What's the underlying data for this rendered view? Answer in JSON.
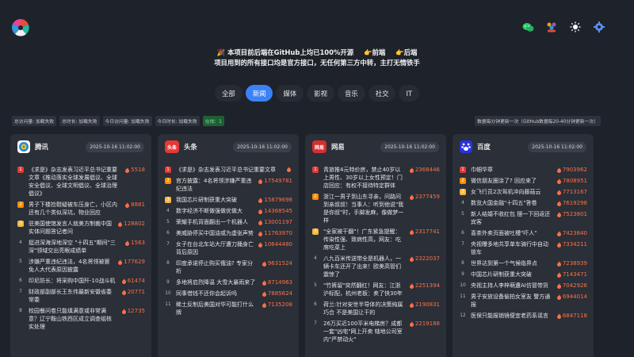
{
  "notice": {
    "line1_prefix": "🎉 本项目前后端在GitHub上均已100%开源",
    "frontend_link": "👉前端",
    "backend_link": "👉后端",
    "line2": "项目用到的所有接口均是官方接口，无任何第三方中转，主打无情铁手"
  },
  "tabs": [
    "全部",
    "新闻",
    "媒体",
    "影视",
    "音乐",
    "社交",
    "IT"
  ],
  "active_tab": "新闻",
  "stats": [
    "总访问量: 加载失败",
    "总时长: 加载失败",
    "今日访问量: 加载失败",
    "今日时长: 加载失败"
  ],
  "online": "在线：1",
  "update_note": "数据每分钟更新一次（GitHub数据每20-40分钟更新一次）",
  "colors": {
    "accent": "#3b82f6",
    "bg": "#1e222a",
    "card": "#2a2f38",
    "heat": "#ff7043"
  },
  "icons": [
    "wechat-icon",
    "community-icon",
    "theme-sun-icon",
    "settings-gear-icon"
  ],
  "columns": [
    {
      "name": "腾讯",
      "logo_text": "",
      "logo_color": "#ffffff",
      "time": "2025-10-16 11:02:00",
      "items": [
        {
          "rank": "1",
          "title": "《求是》杂志发表习近平总书记重要文章《推动落实全球发展倡议、全球安全倡议、全球文明倡议、全球治理倡议》",
          "heat": "5518"
        },
        {
          "rank": "2",
          "title": "男子下楼捡鞋疑被车压身亡，小区内还有几个类似深坑，物业回应",
          "heat": "8881"
        },
        {
          "rank": "3",
          "title": "驻美国使馆发言人就美方制裁中国实体问题答记者问",
          "heat": "128802"
        },
        {
          "rank": "4",
          "title": "挺进深海深地深空 \"十四五\"期间\"三深\"领域交出亮眼成绩单",
          "heat": "1563"
        },
        {
          "rank": "5",
          "title": "涉嫌严重违纪违法，4名将领被罢免人大代表原因披露",
          "heat": "177629"
        },
        {
          "rank": "6",
          "title": "印尼防长：将采购中国歼-10战斗机",
          "heat": "61474"
        },
        {
          "rank": "7",
          "title": "财政部副部长王东伟最新安徽省委常委",
          "heat": "20771"
        },
        {
          "rank": "8",
          "title": "校园餐问卷只能填满意或非常满意？辽宁鞍山铁西区成立调查组核实处理",
          "heat": "12735"
        }
      ]
    },
    {
      "name": "头条",
      "logo_text": "头条",
      "logo_color": "#e53935",
      "time": "2025-10-16 11:02:00",
      "items": [
        {
          "rank": "1",
          "title": "《求是》杂志发表习近平总书记重要文章",
          "heat": ""
        },
        {
          "rank": "2",
          "title": "官方披露：4名将领涉嫌严重违纪违法",
          "heat": "17549781"
        },
        {
          "rank": "3",
          "title": "我国芯片研制获重大突破",
          "heat": "15879698"
        },
        {
          "rank": "4",
          "title": "数字经济不断做强做优做大",
          "heat": "14368545"
        },
        {
          "rank": "5",
          "title": "荣耀手机背面翻出一个机器人",
          "heat": "13001197"
        },
        {
          "rank": "6",
          "title": "美威胁停买中国油或为虚张声势",
          "heat": "11763970"
        },
        {
          "rank": "7",
          "title": "女子在台北车站大厅遭刀捅身亡背后原因",
          "heat": "10644480"
        },
        {
          "rank": "8",
          "title": "印度承诺停止购买俄油? 专家分析",
          "heat": "9631524"
        },
        {
          "rank": "9",
          "title": "多地将启烈降温 大雪大暴雨来了",
          "heat": "8714963"
        },
        {
          "rank": "10",
          "title": "同事借钱不还你会起诉吗",
          "heat": "7885624"
        },
        {
          "rank": "11",
          "title": "稀土反制后美国对华可能打什么牌",
          "heat": "7135208"
        }
      ]
    },
    {
      "name": "网易",
      "logo_text": "网易",
      "logo_color": "#d32f2f",
      "time": "2025-10-16 11:02:00",
      "items": [
        {
          "rank": "1",
          "title": "青旅推4元特价房，禁止40岁以上男性、30岁以上女性预定！门店回应：有权不接待特定群体",
          "heat": "2368446"
        },
        {
          "rank": "2",
          "title": "浙江一男子到山东寻亲，问路问到亲叔叔！当事人：听到他说\"我是你叔\"时，手脚发麻，像做梦一样",
          "heat": "2377459"
        },
        {
          "rank": "3",
          "title": "\"全家被干翻\"！广东紧急提醒：传染性强、致病性高，网友：吃席吃菜上",
          "heat": "2317741"
        },
        {
          "rank": "4",
          "title": "八九百米传送带全是机器人，一辆卡车还开了出来！欧美高管们震惊了",
          "heat": "2322037"
        },
        {
          "rank": "5",
          "title": "\"竹裤留\"突然翻红！网友：江浙沪标配，杭州老板：卖了快30年",
          "heat": "2251394"
        },
        {
          "rank": "6",
          "title": "荷兰:针对安世半导体的决策纯属巧合 不是美国让干的",
          "heat": "2190831"
        },
        {
          "rank": "7",
          "title": "26万买近100平米电梯房？成都一套\"凶宅\"网上开卖 辖地公司室内\"严禁动火\"",
          "heat": "2219188"
        }
      ]
    },
    {
      "name": "百度",
      "logo_text": "百",
      "logo_color": "#2932e1",
      "time": "2025-10-16 11:02:00",
      "items": [
        {
          "rank": "1",
          "title": "巾帼华章",
          "heat": "7903962"
        },
        {
          "rank": "2",
          "title": "微信朋友圈涂了? 回应来了",
          "heat": "7808951"
        },
        {
          "rank": "3",
          "title": "女飞行员2次驾机冲向藤菇云",
          "heat": "7713167"
        },
        {
          "rank": "4",
          "title": "数览大国金融\"十四五\"答卷",
          "heat": "7619298"
        },
        {
          "rank": "5",
          "title": "新人结婚不收红包 摆一下回返还宾客",
          "heat": "7523801"
        },
        {
          "rank": "6",
          "title": "喜茶外卖页面被吐槽\"吓人\"",
          "heat": "7423840"
        },
        {
          "rank": "7",
          "title": "央视曝多地共享单车骑行中自动锁车",
          "heat": "7334211"
        },
        {
          "rank": "8",
          "title": "世界达到第一个气候临界点",
          "heat": "7238939"
        },
        {
          "rank": "9",
          "title": "中国芯片研制获重大突破",
          "heat": "7143471"
        },
        {
          "rank": "10",
          "title": "央视主持人李梓萌遭AI仿冒带货",
          "heat": "7042926"
        },
        {
          "rank": "11",
          "title": "男子安放设备偷拍女室友 警方通报",
          "heat": "6944014"
        },
        {
          "rank": "12",
          "title": "医保只能报销镜便宜老药系谣言",
          "heat": "6847118"
        }
      ]
    }
  ]
}
